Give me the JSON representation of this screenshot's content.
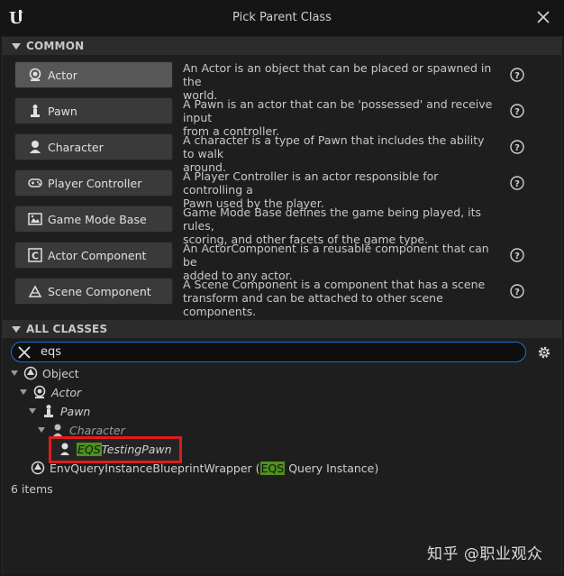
{
  "window": {
    "title": "Pick Parent Class"
  },
  "sections": {
    "common": "COMMON",
    "all_classes": "ALL CLASSES"
  },
  "common_classes": [
    {
      "label": "Actor",
      "description_line1": "An Actor is an object that can be placed or spawned in the",
      "description_line2": "world.",
      "icon": "actor-icon",
      "active": true
    },
    {
      "label": "Pawn",
      "description_line1": "A Pawn is an actor that can be 'possessed' and receive input",
      "description_line2": "from a controller.",
      "icon": "pawn-icon"
    },
    {
      "label": "Character",
      "description_line1": "A character is a type of Pawn that includes the ability to walk",
      "description_line2": "around.",
      "icon": "character-icon"
    },
    {
      "label": "Player Controller",
      "description_line1": "A Player Controller is an actor responsible for controlling a",
      "description_line2": "Pawn used by the player.",
      "icon": "gamepad-icon"
    },
    {
      "label": "Game Mode Base",
      "description_line1": "Game Mode Base defines the game being played, its rules,",
      "description_line2": "scoring, and other facets of the game type.",
      "icon": "game-mode-icon"
    },
    {
      "label": "Actor Component",
      "description_line1": "An ActorComponent is a reusable component that can be",
      "description_line2": "added to any actor.",
      "icon": "actor-component-icon"
    },
    {
      "label": "Scene Component",
      "description_line1": "A Scene Component is a component that has a scene",
      "description_line2": "transform and can be attached to other scene components.",
      "icon": "scene-component-icon"
    }
  ],
  "search": {
    "value": "eqs"
  },
  "tree": {
    "object": "Object",
    "actor": "Actor",
    "pawn": "Pawn",
    "character": "Character",
    "eqs_testing_pawn_match": "EQS",
    "eqs_testing_pawn_rest": "TestingPawn",
    "env_query_prefix": "EnvQueryInstanceBlueprintWrapper (",
    "env_query_match": "EQS",
    "env_query_suffix": " Query Instance)"
  },
  "status": {
    "item_count": "6 items"
  },
  "watermark": "知乎 @职业观众",
  "colors": {
    "accent": "#1d6fd6",
    "highlight": "#4f8f1f",
    "selection_outline": "#e01b1b"
  }
}
